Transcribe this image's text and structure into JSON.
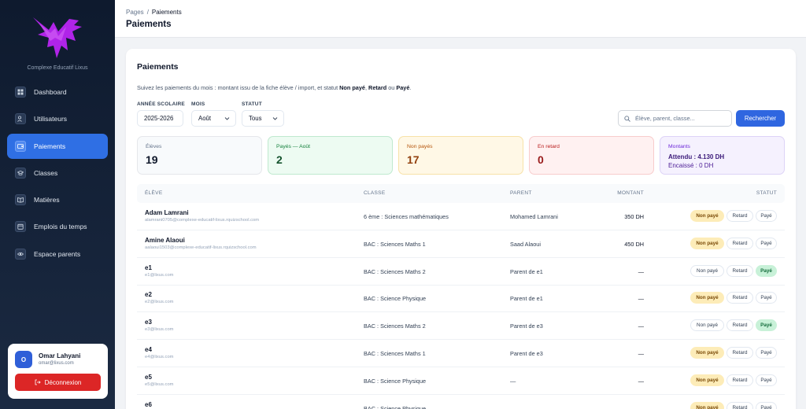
{
  "brand": {
    "name": "Complexe Educatif Lixus",
    "logo_color": "#b024e8"
  },
  "nav": [
    {
      "label": "Dashboard",
      "icon": "grid-icon",
      "active": false
    },
    {
      "label": "Utilisateurs",
      "icon": "users-icon",
      "active": false
    },
    {
      "label": "Paiements",
      "icon": "wallet-icon",
      "active": true
    },
    {
      "label": "Classes",
      "icon": "graduation-cap-icon",
      "active": false
    },
    {
      "label": "Matières",
      "icon": "book-icon",
      "active": false
    },
    {
      "label": "Emplois du temps",
      "icon": "calendar-icon",
      "active": false
    },
    {
      "label": "Espace parents",
      "icon": "eye-icon",
      "active": false
    }
  ],
  "user": {
    "initial": "O",
    "name": "Omar Lahyani",
    "email": "omar@lixus.com",
    "logout_label": "Déconnexion"
  },
  "header": {
    "breadcrumb_root": "Pages",
    "breadcrumb_sep": "/",
    "breadcrumb_current": "Paiements",
    "title": "Paiements"
  },
  "card": {
    "title": "Paiements",
    "desc_prefix": "Suivez les paiements du mois : montant issu de la fiche élève / import, et statut ",
    "desc_np": "Non payé",
    "desc_comma": ", ",
    "desc_retard": "Retard",
    "desc_ou": " ou ",
    "desc_paye": "Payé",
    "desc_end": "."
  },
  "filters": {
    "year_label": "ANNÉE SCOLAIRE",
    "year_value": "2025-2026",
    "month_label": "MOIS",
    "month_value": "Août",
    "status_label": "STATUT",
    "status_value": "Tous",
    "search_placeholder": "Élève, parent, classe...",
    "search_button": "Rechercher"
  },
  "stats": {
    "eleves": {
      "label": "Élèves",
      "value": "19"
    },
    "payes": {
      "label": "Payés — Août",
      "value": "2"
    },
    "non_payes": {
      "label": "Non payés",
      "value": "17"
    },
    "retard": {
      "label": "En retard",
      "value": "0"
    },
    "montants": {
      "label": "Montants",
      "attendu": "Attendu : 4.130 DH",
      "encaisse": "Encaissé : 0 DH"
    }
  },
  "colors": {
    "accent": "#2f6fe4",
    "danger": "#dc2626",
    "paid": "#c8f1d8",
    "unpaid": "#fdecb8"
  },
  "table": {
    "headers": {
      "eleve": "ÉLÈVE",
      "classe": "CLASSE",
      "parent": "PARENT",
      "montant": "MONTANT",
      "statut": "STATUT"
    },
    "status_labels": {
      "np": "Non payé",
      "r": "Retard",
      "p": "Payé"
    },
    "rows": [
      {
        "name": "Adam Lamrani",
        "email": "alamrani0705@complexe-educatif-lixus.rquizschool.com",
        "classe": "6 ème : Sciences mathématiques",
        "parent": "Mohamed Lamrani",
        "montant": "350 DH",
        "status": "np"
      },
      {
        "name": "Amine Alaoui",
        "email": "aalaoui1503@complexe-educatif-lixus.rquizschool.com",
        "classe": "BAC : Sciences Maths 1",
        "parent": "Saad Alaoui",
        "montant": "450 DH",
        "status": "np"
      },
      {
        "name": "e1",
        "email": "e1@lixus.com",
        "classe": "BAC : Sciences Maths 2",
        "parent": "Parent de e1",
        "montant": "—",
        "status": "p"
      },
      {
        "name": "e2",
        "email": "e2@lixus.com",
        "classe": "BAC : Science Physique",
        "parent": "Parent de e1",
        "montant": "—",
        "status": "np"
      },
      {
        "name": "e3",
        "email": "e3@lixus.com",
        "classe": "BAC : Sciences Maths 2",
        "parent": "Parent de e3",
        "montant": "—",
        "status": "p"
      },
      {
        "name": "e4",
        "email": "e4@lixus.com",
        "classe": "BAC : Sciences Maths 1",
        "parent": "Parent de e3",
        "montant": "—",
        "status": "np"
      },
      {
        "name": "e5",
        "email": "e5@lixus.com",
        "classe": "BAC : Science Physique",
        "parent": "—",
        "montant": "—",
        "status": "np"
      },
      {
        "name": "e6",
        "email": "",
        "classe": "BAC : Science Physique",
        "parent": "—",
        "montant": "—",
        "status": "np"
      }
    ]
  }
}
